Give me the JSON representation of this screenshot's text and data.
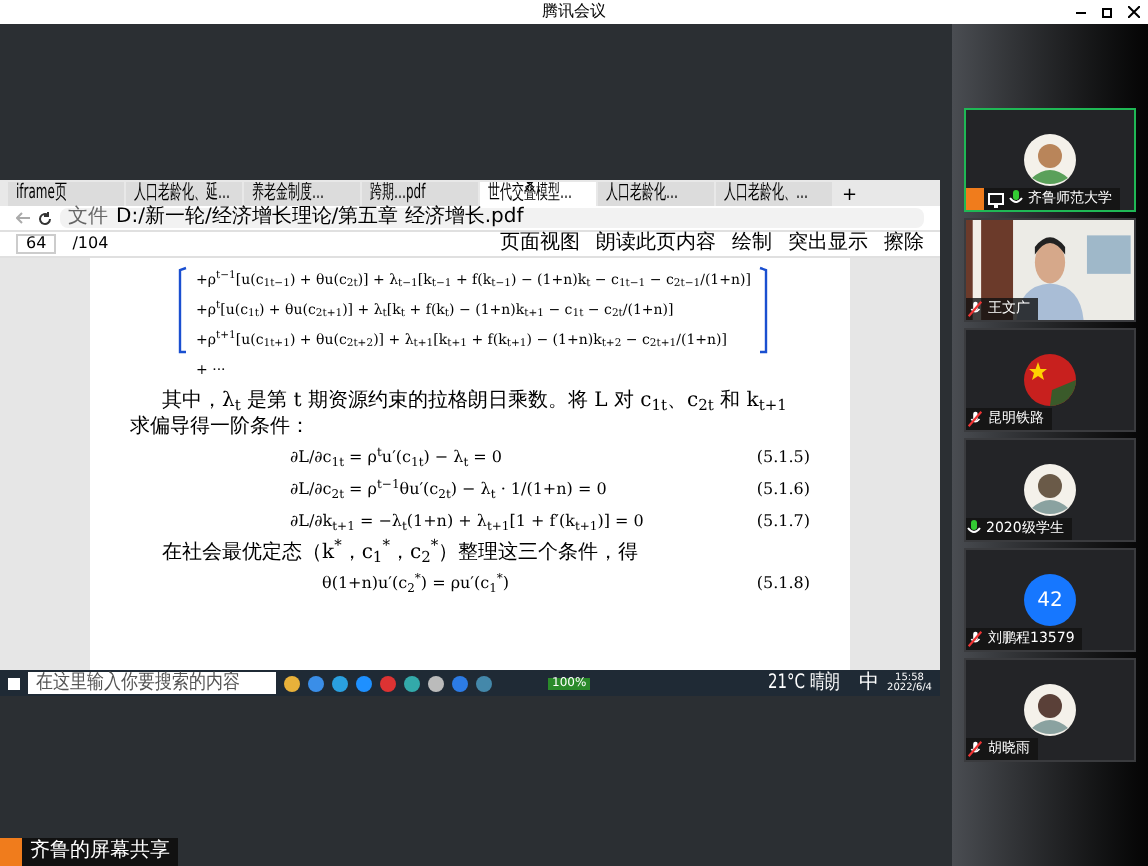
{
  "window": {
    "title": "腾讯会议"
  },
  "browser": {
    "tabs": [
      {
        "label": "iframe页",
        "selected": false
      },
      {
        "label": "人口老龄化、延…",
        "selected": false
      },
      {
        "label": "养老金制度…",
        "selected": false
      },
      {
        "label": "跨期…pdf",
        "selected": false
      },
      {
        "label": "世代交叠模型…",
        "selected": true
      },
      {
        "label": "人口老龄化…",
        "selected": false
      },
      {
        "label": "人口老龄化、…",
        "selected": false
      }
    ],
    "new_tab": "+",
    "address": {
      "scheme": "文件",
      "url": "D:/新一轮/经济增长理论/第五章 经济增长.pdf"
    },
    "page": {
      "current": "64",
      "total": "/104"
    },
    "toolbar": [
      "页面视图",
      "朗读此页内容",
      "绘制",
      "突出显示",
      "擦除"
    ]
  },
  "document": {
    "terms": [
      "+ρ$^{t−1}$[u(c$_{1t−1}$) + θu(c$_{2t}$)] + λ$_{t−1}$[k$_{t−1}$ + f(k$_{t−1}$) − (1+n)k$_{t}$ − c$_{1t−1}$ − c$_{2t−1}$/(1+n)]",
      "+ρ$^{t}$[u(c$_{1t}$) + θu(c$_{2t+1}$)] + λ$_{t}$[k$_{t}$ + f(k$_{t}$) − (1+n)k$_{t+1}$ − c$_{1t}$ − c$_{2t}$/(1+n)]",
      "+ρ$^{t+1}$[u(c$_{1t+1}$) + θu(c$_{2t+2}$)] + λ$_{t+1}$[k$_{t+1}$ + f(k$_{t+1}$) − (1+n)k$_{t+2}$ − c$_{2t+1}$/(1+n)]",
      "+ ···"
    ],
    "paragraph_1": "其中，λ$_{t}$ 是第 t 期资源约束的拉格朗日乘数。将 L 对 c$_{1t}$、c$_{2t}$ 和 k$_{t+1}$ 求偏导得一阶条件：",
    "equations": [
      {
        "expr": "∂L/∂c$_{1t}$ = ρ$^{t}$u′(c$_{1t}$) − λ$_{t}$ = 0",
        "number": "(5.1.5)"
      },
      {
        "expr": "∂L/∂c$_{2t}$ = ρ$^{t−1}$θu′(c$_{2t}$) − λ$_{t}$ · 1/(1+n) = 0",
        "number": "(5.1.6)"
      },
      {
        "expr": "∂L/∂k$_{t+1}$ = −λ$_{t}$(1+n) + λ$_{t+1}$[1 + f′(k$_{t+1}$)] = 0",
        "number": "(5.1.7)"
      }
    ],
    "paragraph_2": "在社会最优定态（k$^{*}$，c$_{1}$$^{*}$，c$_{2}$$^{*}$）整理这三个条件，得",
    "equation_last": {
      "expr": "θ(1+n)u′(c$_{2}$$^{*}$) = ρu′(c$_{1}$$^{*}$)",
      "number": "(5.1.8)"
    }
  },
  "taskbar": {
    "search": {
      "placeholder": "在这里输入你要搜索的内容"
    },
    "battery": "100%",
    "weather": "21°C 晴朗",
    "time": "15:58",
    "date": "2022/6/4",
    "ime": "中"
  },
  "share_label": "齐鲁的屏幕共享",
  "participants": [
    {
      "name": "齐鲁师范大学",
      "kind": "avatar",
      "muted": false,
      "sharing": true,
      "selected": true
    },
    {
      "name": "王文广",
      "kind": "video",
      "muted": true,
      "sharing": false,
      "selected": false
    },
    {
      "name": "昆明铁路",
      "kind": "flag",
      "muted": true,
      "sharing": false,
      "selected": false
    },
    {
      "name": "2020级学生",
      "kind": "avatar",
      "muted": false,
      "sharing": false,
      "selected": false
    },
    {
      "name": "刘鹏程13579",
      "kind": "initials",
      "initials": "42",
      "muted": true,
      "sharing": false,
      "selected": false
    },
    {
      "name": "胡晓雨",
      "kind": "avatar",
      "muted": true,
      "sharing": false,
      "selected": false
    }
  ]
}
